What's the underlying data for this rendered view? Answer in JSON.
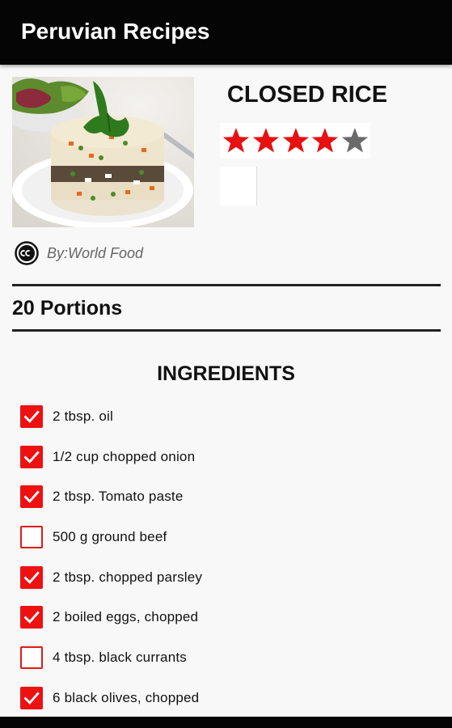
{
  "app": {
    "title": "Peruvian Recipes"
  },
  "recipe": {
    "title": "CLOSED RICE",
    "rating": 4,
    "rating_max": 5,
    "author": "By:World Food",
    "portions": "20 Portions"
  },
  "ingredients": {
    "heading": "INGREDIENTS",
    "items": [
      {
        "text": "2 tbsp. oil",
        "checked": true
      },
      {
        "text": "1/2 cup chopped onion",
        "checked": true
      },
      {
        "text": "2 tbsp. Tomato paste",
        "checked": true
      },
      {
        "text": "500 g ground beef",
        "checked": false
      },
      {
        "text": "2 tbsp. chopped parsley",
        "checked": true
      },
      {
        "text": "2 boiled eggs, chopped",
        "checked": true
      },
      {
        "text": "4 tbsp. black currants",
        "checked": false
      },
      {
        "text": "6 black olives, chopped",
        "checked": true
      }
    ]
  },
  "icons": {
    "license": "creative-commons-icon",
    "star_filled": "star-filled-icon",
    "star_empty": "star-empty-icon",
    "check": "check-icon"
  },
  "colors": {
    "appbar": "#050505",
    "accent": "#ee1111",
    "star_filled": "#e81010",
    "star_empty": "#6a6a6a",
    "background": "#f8f8f8"
  }
}
